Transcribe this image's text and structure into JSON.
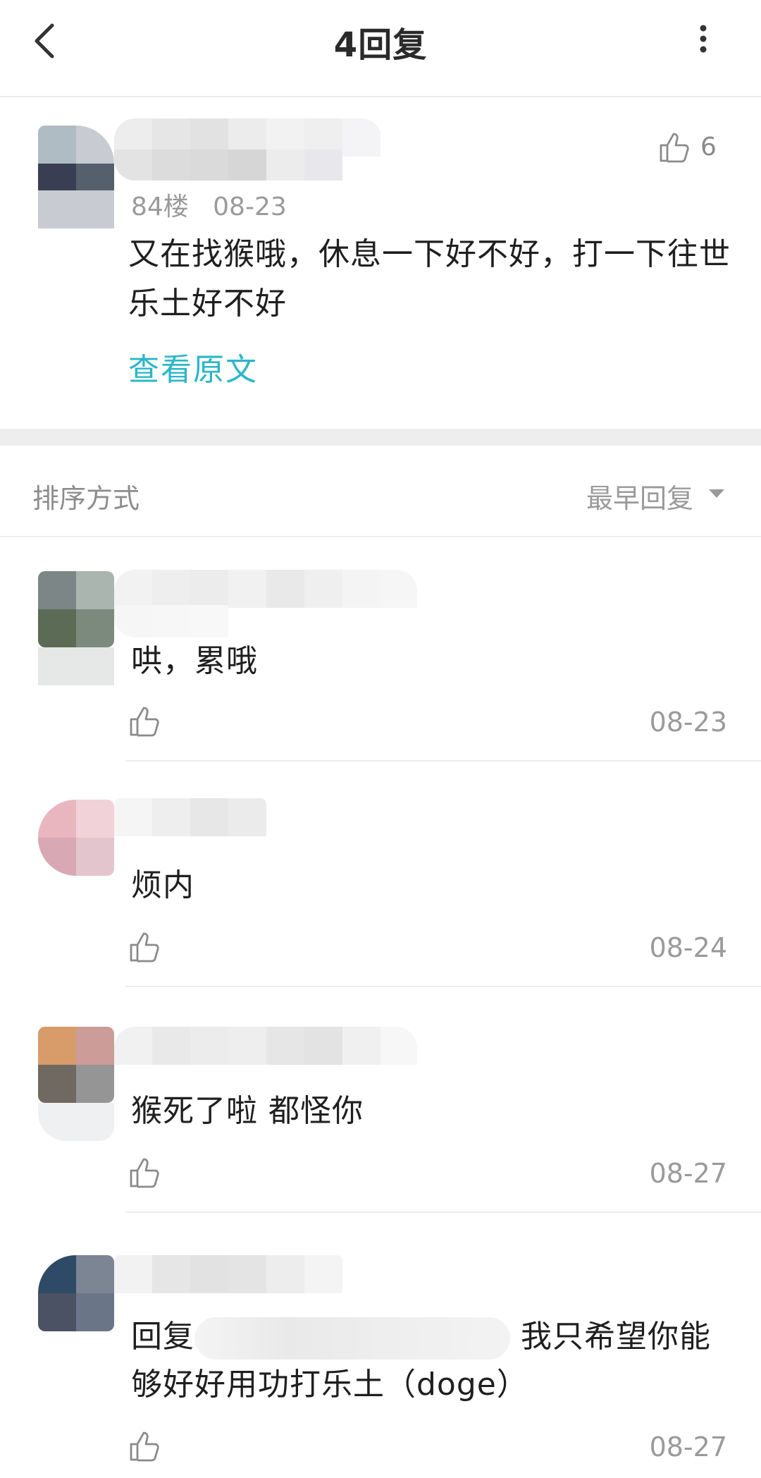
{
  "header": {
    "title": "4回复",
    "back_icon": "back-chevron-icon",
    "more_icon": "more-vertical-icon"
  },
  "post": {
    "like_count": "6",
    "floor": "84楼",
    "date": "08-23",
    "body": "又在找猴哦，休息一下好不好，打一下往世乐土好不好",
    "view_original": "查看原文"
  },
  "sort": {
    "label": "排序方式",
    "value": "最早回复",
    "caret_icon": "caret-down-icon"
  },
  "replies": [
    {
      "text": "哄，累哦",
      "date": "08-23"
    },
    {
      "text": "烦内",
      "date": "08-24"
    },
    {
      "text": "猴死了啦 都怪你",
      "date": "08-27"
    },
    {
      "prefix": "回复",
      "text_after": "我只希望你能",
      "text_line2": "够好好用功打乐土（doge）",
      "date": "08-27"
    }
  ],
  "colors": {
    "accent": "#2bb6c9",
    "muted": "#9a9a9a",
    "band": "#eeeeee"
  }
}
